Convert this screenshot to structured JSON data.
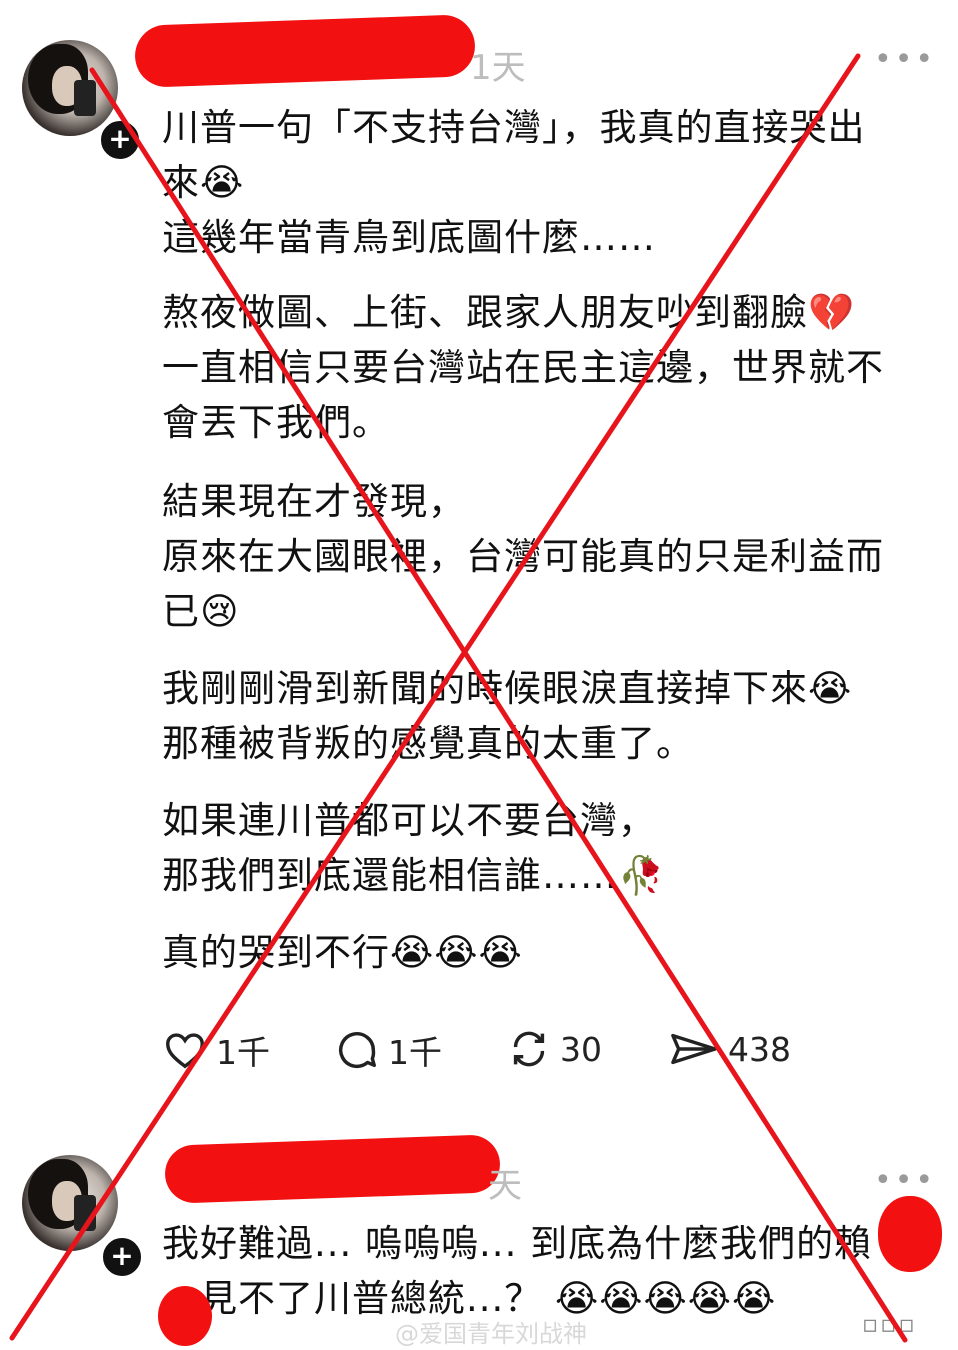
{
  "posts": [
    {
      "time": "1天",
      "lines_p1": [
        "川普一句「不支持台灣」，我真的直接哭出",
        "來😭",
        "這幾年當青鳥到底圖什麼……"
      ],
      "lines_p2": [
        "熬夜做圖、上街、跟家人朋友吵到翻臉💔",
        "一直相信只要台灣站在民主這邊，世界就不",
        "會丟下我們。"
      ],
      "lines_p3": [
        "結果現在才發現，",
        "原來在大國眼裡，台灣可能真的只是利益而",
        "已😢"
      ],
      "lines_p4": [
        "我剛剛滑到新聞的時候眼淚直接掉下來😭",
        "那種被背叛的感覺真的太重了。"
      ],
      "lines_p5": [
        "如果連川普都可以不要台灣，",
        "那我們到底還能相信誰……🥀"
      ],
      "lines_p6": [
        "真的哭到不行😭😭😭"
      ],
      "likes": "1千",
      "replies": "1千",
      "reposts": "30",
      "shares": "438"
    },
    {
      "time": "天",
      "line1": "我好難過... 嗚嗚嗚... 到底為什麼我們的賴",
      "line2": "見不了川普總統...？ 😭😭😭😭😭"
    }
  ],
  "more_icon": "•••",
  "watermark": "@爱国青年刘战神",
  "colors": {
    "redaction": "#f21010",
    "cross": "#e8141c",
    "muted": "#bdbdbd"
  }
}
